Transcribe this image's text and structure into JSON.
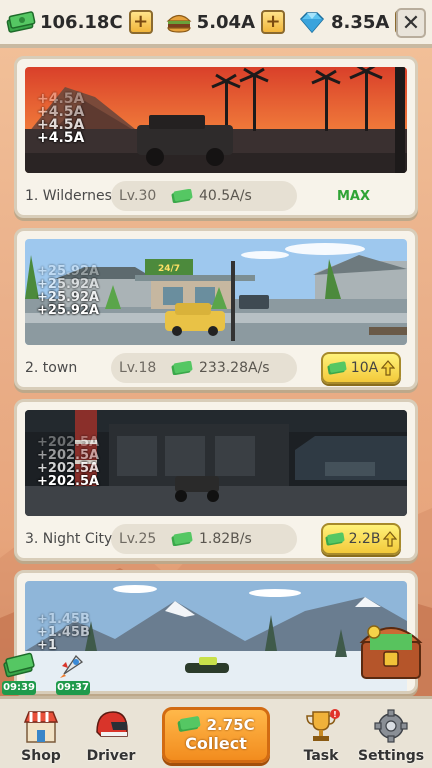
{
  "currencies": [
    {
      "icon": "cash-stack-icon",
      "value": "106.18C"
    },
    {
      "icon": "burger-icon",
      "value": "5.04A"
    },
    {
      "icon": "diamond-icon",
      "value": "8.35A"
    }
  ],
  "floating_text": {
    "wilderness": [
      "+4.5A",
      "+4.5A",
      "+4.5A",
      "+4.5A"
    ],
    "town": [
      "+25.92A",
      "+25.92A",
      "+25.92A",
      "+25.92A"
    ],
    "night_city": [
      "+202.5A",
      "+202.5A",
      "+202.5A",
      "+202.5A"
    ],
    "snow": [
      "+1.45B",
      "+1.45B",
      "+1"
    ]
  },
  "locations": [
    {
      "name": "1. Wilderness",
      "level": "Lv.30",
      "rate": "40.5A/s",
      "status": "MAX"
    },
    {
      "name": "2. town",
      "level": "Lv.18",
      "rate": "233.28A/s",
      "upgrade_cost": "10A"
    },
    {
      "name": "3. Night City",
      "level": "Lv.25",
      "rate": "1.82B/s",
      "upgrade_cost": "2.2B"
    }
  ],
  "store_sign": "24/7",
  "boosts": [
    {
      "icon": "cash-boost-icon",
      "timer": "09:39"
    },
    {
      "icon": "rocket-boost-icon",
      "timer": "09:37"
    }
  ],
  "bottom_nav": {
    "shop": "Shop",
    "driver": "Driver",
    "collect_amount": "2.75C",
    "collect_label": "Collect",
    "task": "Task",
    "settings": "Settings"
  },
  "colors": {
    "accent_green": "#2fa335",
    "button_yellow": "#f3c93a",
    "collect_orange": "#f28c1e",
    "timer_green": "#1f9a4b"
  }
}
